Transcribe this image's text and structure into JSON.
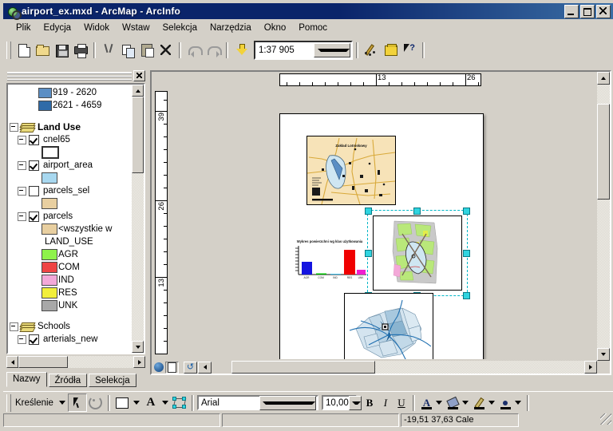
{
  "window": {
    "title": "airport_ex.mxd - ArcMap - ArcInfo",
    "icon": "arcmap-globe-icon",
    "minimize_label": "minimize-button",
    "maximize_label": "maximize-button",
    "close_label": "close-button"
  },
  "menubar": {
    "items": [
      {
        "label": "Plik"
      },
      {
        "label": "Edycja"
      },
      {
        "label": "Widok"
      },
      {
        "label": "Wstaw"
      },
      {
        "label": "Selekcja"
      },
      {
        "label": "Narzędzia"
      },
      {
        "label": "Okno"
      },
      {
        "label": "Pomoc"
      }
    ]
  },
  "toolbar": {
    "buttons": [
      {
        "name": "new-document-icon",
        "tip": "Nowy"
      },
      {
        "name": "open-folder-icon",
        "tip": "Otwórz"
      },
      {
        "name": "save-disk-icon",
        "tip": "Zapisz"
      },
      {
        "name": "print-icon",
        "tip": "Drukuj"
      },
      {
        "name": "cut-scissors-icon",
        "tip": "Wytnij"
      },
      {
        "name": "copy-icon",
        "tip": "Kopiuj"
      },
      {
        "name": "paste-icon",
        "tip": "Wklej"
      },
      {
        "name": "delete-x-icon",
        "tip": "Usuń"
      },
      {
        "name": "undo-icon",
        "tip": "Cofnij"
      },
      {
        "name": "redo-icon",
        "tip": "Ponów"
      },
      {
        "name": "add-data-icon",
        "tip": "Dodaj dane"
      }
    ],
    "scale": {
      "value": "1:37 905",
      "dropdown": "chevron-down-icon"
    },
    "right_buttons": [
      {
        "name": "editor-tool-icon",
        "tip": "Edytor"
      },
      {
        "name": "arctoolbox-icon",
        "tip": "ArcToolbox"
      },
      {
        "name": "context-help-icon",
        "tip": "Pomoc kontekstowa"
      }
    ]
  },
  "toc": {
    "panel_close": "close-icon",
    "scroll": {
      "up": "scroll-up-arrow",
      "down": "scroll-down-arrow",
      "left": "scroll-left-arrow",
      "right": "scroll-right-arrow"
    },
    "legend_top": [
      {
        "label": "919 - 2620",
        "color": "#5b8ec4"
      },
      {
        "label": "2621 - 4659",
        "color": "#2f6ba8"
      }
    ],
    "groups": [
      {
        "name": "Land Use",
        "expander": "minus",
        "layers": [
          {
            "label": "cnel65",
            "checked": true,
            "swatch": "#ffffff",
            "outline": "#303030"
          },
          {
            "label": "airport_area",
            "checked": true,
            "swatch": "#a8d8f0",
            "outline": "#4a6a80"
          },
          {
            "label": "parcels_sel",
            "checked": false,
            "swatch": "#e8cfa0",
            "outline": "#7a6540"
          },
          {
            "label": "parcels",
            "checked": true,
            "swatch": null,
            "outline": null
          }
        ]
      }
    ],
    "parcels_symbology": {
      "all_other": {
        "label": "<wszystkie w",
        "color": "#e8cfa0"
      },
      "field": "LAND_USE",
      "classes": [
        {
          "label": "AGR",
          "color": "#8ef24a"
        },
        {
          "label": "COM",
          "color": "#ef4444"
        },
        {
          "label": "IND",
          "color": "#f3a8d8"
        },
        {
          "label": "RES",
          "color": "#f2ef3a"
        },
        {
          "label": "UNK",
          "color": "#a8a8a8"
        }
      ]
    },
    "schools_group": {
      "name": "Schools",
      "expander": "minus",
      "layers": [
        {
          "label": "arterials_new",
          "checked": true
        }
      ]
    },
    "tabs": [
      {
        "label": "Nazwy",
        "active": true
      },
      {
        "label": "Źródła",
        "active": false
      },
      {
        "label": "Selekcja",
        "active": false
      }
    ]
  },
  "layout": {
    "horizontal_ruler_ticks": [
      "13",
      "26"
    ],
    "vertical_ruler_ticks": [
      "39",
      "26",
      "13"
    ],
    "elements": [
      {
        "name": "overview-map-frame",
        "title": "Zakład Lotniskowy",
        "selected": false
      },
      {
        "name": "landuse-bar-chart",
        "title": "Wykres powierzchni wg klas użytkowania",
        "selected": false
      },
      {
        "name": "landuse-map-frame",
        "selected": true
      },
      {
        "name": "county-map-frame",
        "selected": false
      }
    ],
    "selection_handles": 8,
    "view_buttons": [
      {
        "name": "layout-view-icon"
      },
      {
        "name": "refresh-icon"
      },
      {
        "name": "pause-draw-icon"
      }
    ]
  },
  "chart_data": {
    "type": "bar",
    "title": "Wykres powierzchni wg klas użytkowania",
    "categories": [
      "AGR",
      "COM",
      "IND",
      "RES",
      "UNK"
    ],
    "values": [
      42,
      3,
      2,
      78,
      14
    ],
    "colors": [
      "#1414e0",
      "#00c000",
      "#40c0f0",
      "#f00000",
      "#f020d0"
    ],
    "xlabel": "",
    "ylabel": "",
    "ylim": [
      0,
      100
    ],
    "grid": false,
    "legend": "none"
  },
  "drawbar": {
    "menu_label": "Kreślenie",
    "select_tool": "select-arrow-icon",
    "rotate_tool": "rotate-icon",
    "shape_tool": "rectangle-icon",
    "text_tool": "text-A-icon",
    "group_tool": "group-icon",
    "font": {
      "value": "Arial",
      "dropdown": "chevron-down-icon"
    },
    "size": {
      "value": "10,00",
      "dropdown": "chevron-down-icon"
    },
    "bold": "B",
    "italic": "I",
    "underline": "U",
    "font_color": {
      "name": "font-color-icon",
      "color": "#000000"
    },
    "fill_color": {
      "name": "fill-color-icon",
      "color": "#000000"
    },
    "line_color": {
      "name": "line-color-icon",
      "color": "#000000"
    },
    "marker_color": {
      "name": "marker-color-icon",
      "color": "#000000"
    }
  },
  "status": {
    "coordinates": "-19,51  37,63 Cale",
    "resize_grip": "resize-grip-icon"
  }
}
